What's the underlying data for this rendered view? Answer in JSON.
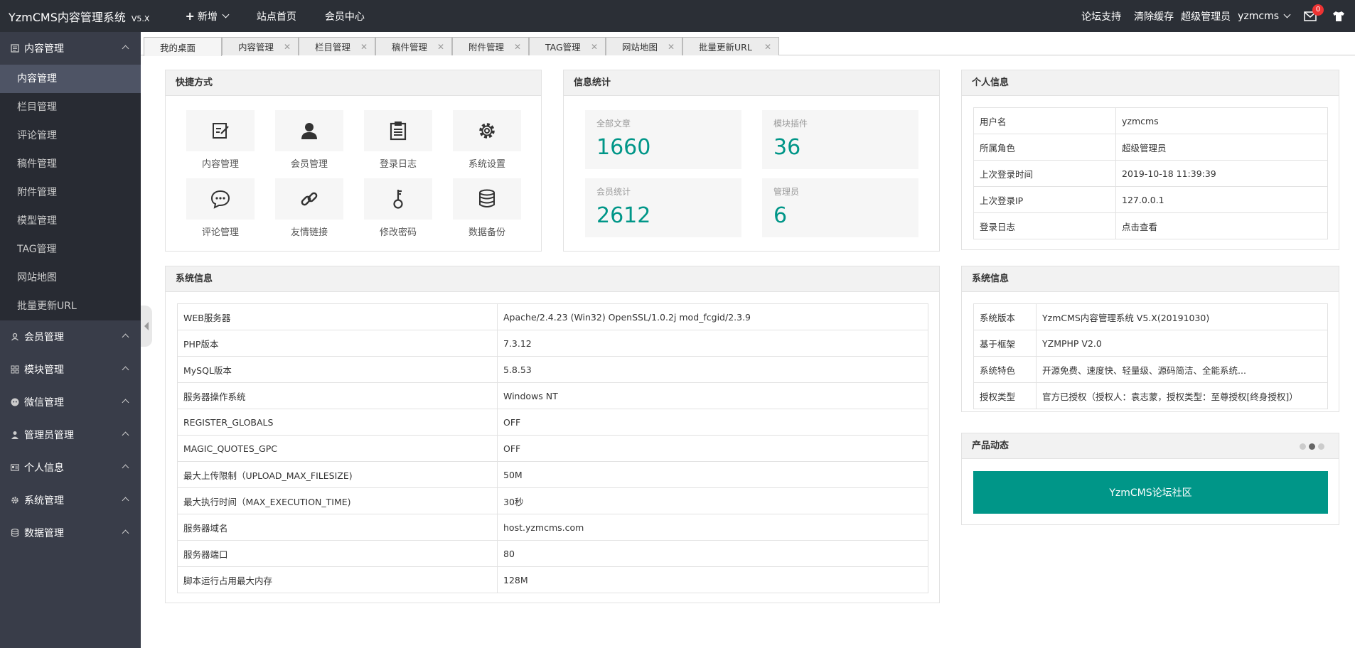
{
  "header": {
    "brand": "YzmCMS内容管理系统",
    "version": "V5.X",
    "nav": [
      {
        "label": "新增",
        "plus": "+"
      },
      {
        "label": "站点首页"
      },
      {
        "label": "会员中心"
      }
    ],
    "right": {
      "forum": "论坛支持",
      "clear_cache": "清除缓存",
      "role": "超级管理员",
      "username": "yzmcms",
      "message_count": "0"
    }
  },
  "sidebar": {
    "groups": [
      {
        "label": "内容管理",
        "icon": "file-icon",
        "open": true,
        "items": [
          "内容管理",
          "栏目管理",
          "评论管理",
          "稿件管理",
          "附件管理",
          "模型管理",
          "TAG管理",
          "网站地图",
          "批量更新URL"
        ]
      },
      {
        "label": "会员管理",
        "icon": "user-icon"
      },
      {
        "label": "模块管理",
        "icon": "grid-icon"
      },
      {
        "label": "微信管理",
        "icon": "wechat-icon"
      },
      {
        "label": "管理员管理",
        "icon": "admin-icon"
      },
      {
        "label": "个人信息",
        "icon": "card-icon"
      },
      {
        "label": "系统管理",
        "icon": "gear-icon"
      },
      {
        "label": "数据管理",
        "icon": "database-icon"
      }
    ]
  },
  "tabs": [
    "我的桌面",
    "内容管理",
    "栏目管理",
    "稿件管理",
    "附件管理",
    "TAG管理",
    "网站地图",
    "批量更新URL"
  ],
  "quick": {
    "title": "快捷方式",
    "items": [
      {
        "label": "内容管理",
        "icon": "edit-icon"
      },
      {
        "label": "会员管理",
        "icon": "user-icon"
      },
      {
        "label": "登录日志",
        "icon": "clipboard-icon"
      },
      {
        "label": "系统设置",
        "icon": "gear-icon"
      },
      {
        "label": "评论管理",
        "icon": "chat-icon"
      },
      {
        "label": "友情链接",
        "icon": "link-icon"
      },
      {
        "label": "修改密码",
        "icon": "key-icon"
      },
      {
        "label": "数据备份",
        "icon": "database-icon"
      }
    ]
  },
  "stats": {
    "title": "信息统计",
    "items": [
      {
        "label": "全部文章",
        "value": "1660"
      },
      {
        "label": "模块插件",
        "value": "36"
      },
      {
        "label": "会员统计",
        "value": "2612"
      },
      {
        "label": "管理员",
        "value": "6"
      }
    ]
  },
  "profile": {
    "title": "个人信息",
    "rows": [
      {
        "k": "用户名",
        "v": "yzmcms"
      },
      {
        "k": "所属角色",
        "v": "超级管理员"
      },
      {
        "k": "上次登录时间",
        "v": "2019-10-18 11:39:39"
      },
      {
        "k": "上次登录IP",
        "v": "127.0.0.1"
      },
      {
        "k": "登录日志",
        "v": "点击查看"
      }
    ]
  },
  "sysinfo": {
    "title": "系统信息",
    "rows": [
      {
        "k": "WEB服务器",
        "v": "Apache/2.4.23 (Win32) OpenSSL/1.0.2j mod_fcgid/2.3.9"
      },
      {
        "k": "PHP版本",
        "v": "7.3.12"
      },
      {
        "k": "MySQL版本",
        "v": "5.8.53"
      },
      {
        "k": "服务器操作系统",
        "v": "Windows NT"
      },
      {
        "k": "REGISTER_GLOBALS",
        "v": "OFF"
      },
      {
        "k": "MAGIC_QUOTES_GPC",
        "v": "OFF"
      },
      {
        "k": "最大上传限制（UPLOAD_MAX_FILESIZE)",
        "v": "50M"
      },
      {
        "k": "最大执行时间（MAX_EXECUTION_TIME)",
        "v": "30秒"
      },
      {
        "k": "服务器域名",
        "v": "host.yzmcms.com"
      },
      {
        "k": "服务器端口",
        "v": "80"
      },
      {
        "k": "脚本运行占用最大内存",
        "v": "128M"
      }
    ]
  },
  "sysinfo2": {
    "title": "系统信息",
    "rows": [
      {
        "k": "系统版本",
        "v": "YzmCMS内容管理系统 V5.X(20191030)"
      },
      {
        "k": "基于框架",
        "v": "YZMPHP V2.0"
      },
      {
        "k": "系统特色",
        "v": "开源免费、速度快、轻量级、源码简洁、全能系统..."
      },
      {
        "k": "授权类型",
        "v": "官方已授权（授权人：袁志蒙，授权类型：至尊授权[终身授权]）"
      }
    ]
  },
  "product": {
    "title": "产品动态",
    "button": "YzmCMS论坛社区"
  },
  "colors": {
    "accent": "#009688",
    "topbar": "#2b2f36",
    "sidebar": "#393d49",
    "link": "#1a1acd"
  }
}
